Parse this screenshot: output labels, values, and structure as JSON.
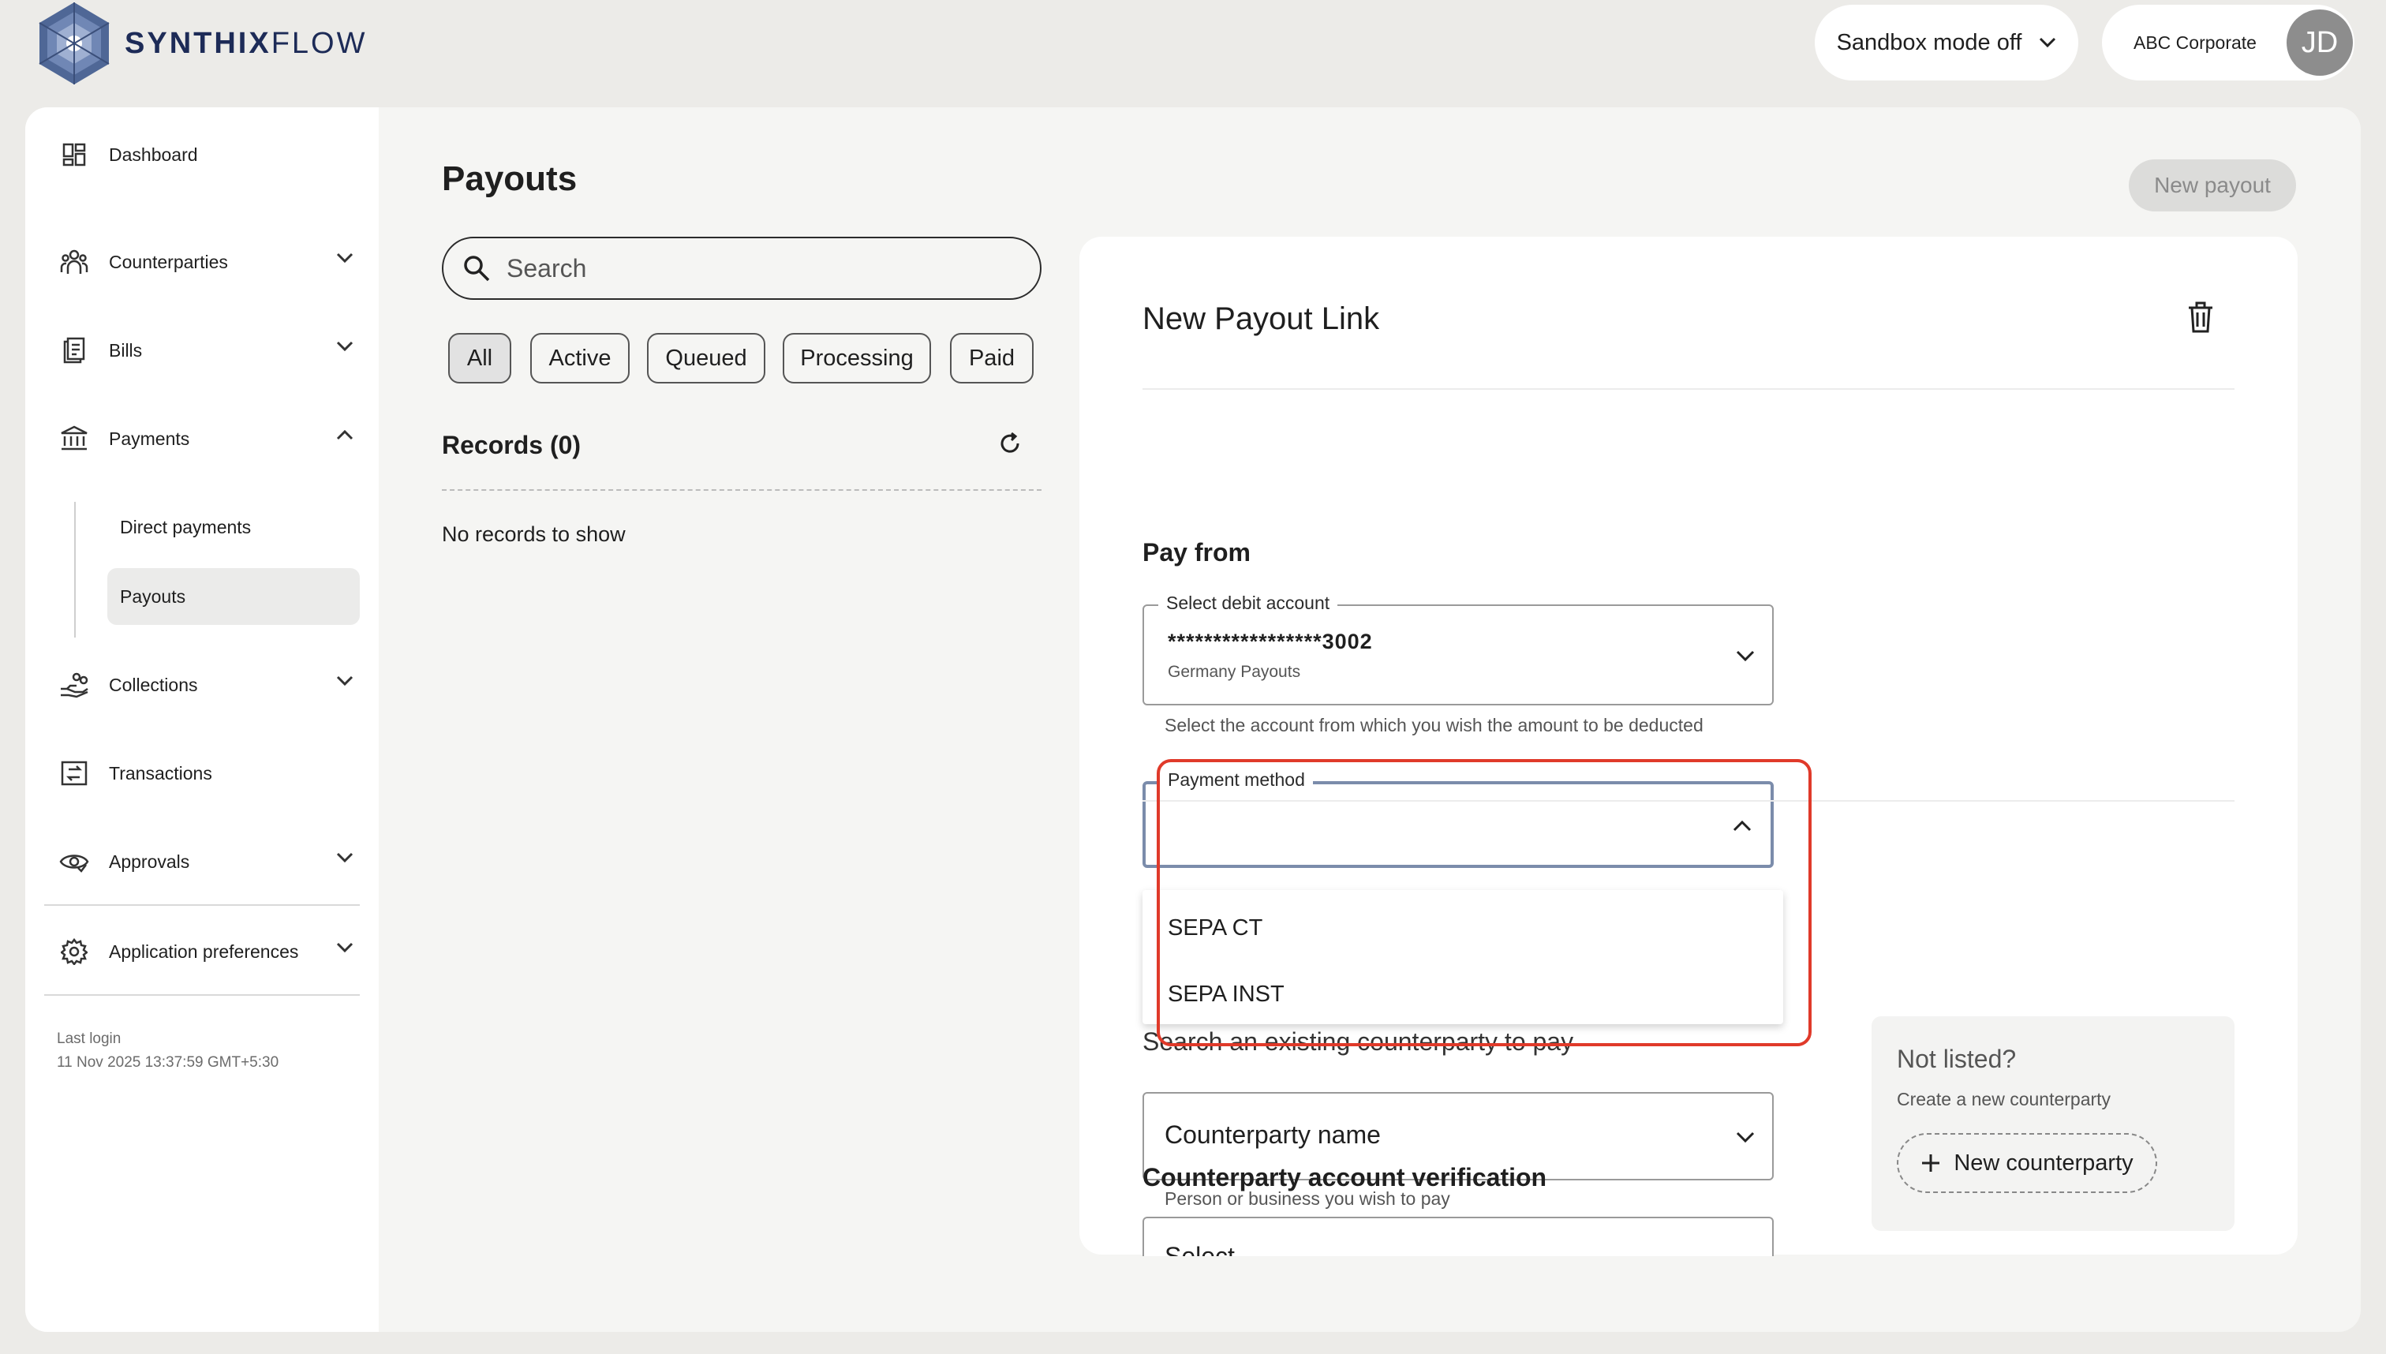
{
  "header": {
    "logo_bold": "SYNTHIX",
    "logo_light": "FLOW",
    "sandbox_label": "Sandbox mode off",
    "account_name": "ABC Corporate",
    "avatar_initials": "JD"
  },
  "sidebar": {
    "items": [
      {
        "label": "Dashboard",
        "icon": "dashboard-icon"
      },
      {
        "label": "Counterparties",
        "icon": "people-icon"
      },
      {
        "label": "Bills",
        "icon": "bill-icon"
      },
      {
        "label": "Payments",
        "icon": "bank-icon"
      },
      {
        "label": "Collections",
        "icon": "hand-coins-icon"
      },
      {
        "label": "Transactions",
        "icon": "transfer-icon"
      },
      {
        "label": "Approvals",
        "icon": "eye-icon"
      },
      {
        "label": "Application preferences",
        "icon": "gear-icon"
      }
    ],
    "payments_sub": [
      "Direct payments",
      "Payouts"
    ],
    "last_login_label": "Last login",
    "last_login_value": "11 Nov 2025 13:37:59 GMT+5:30"
  },
  "payouts": {
    "title": "Payouts",
    "search_placeholder": "Search",
    "filters": [
      "All",
      "Active",
      "Queued",
      "Processing",
      "Paid"
    ],
    "records_label": "Records (0)",
    "empty_text": "No records to show",
    "new_payout_label": "New payout"
  },
  "card": {
    "title": "New Payout Link",
    "pay_from_title": "Pay from",
    "debit_legend": "Select debit account",
    "debit_account": "*****************3002",
    "debit_sub": "Germany Payouts",
    "debit_helper": "Select the account from which you wish the amount to be deducted",
    "payment_method_legend": "Payment method",
    "payment_options": [
      "SEPA CT",
      "SEPA INST"
    ],
    "search_cp_text": "Search an existing counterparty to pay",
    "cp_placeholder": "Counterparty name",
    "cp_helper": "Person or business you wish to pay",
    "not_listed_title": "Not listed?",
    "not_listed_sub": "Create a new counterparty",
    "new_cp_label": "New counterparty",
    "verification_title": "Counterparty account verification",
    "verification_placeholder": "Select"
  },
  "colors": {
    "brand": "#1d2b57",
    "highlight": "#e03a2a",
    "focus_border": "#7b8cab"
  }
}
